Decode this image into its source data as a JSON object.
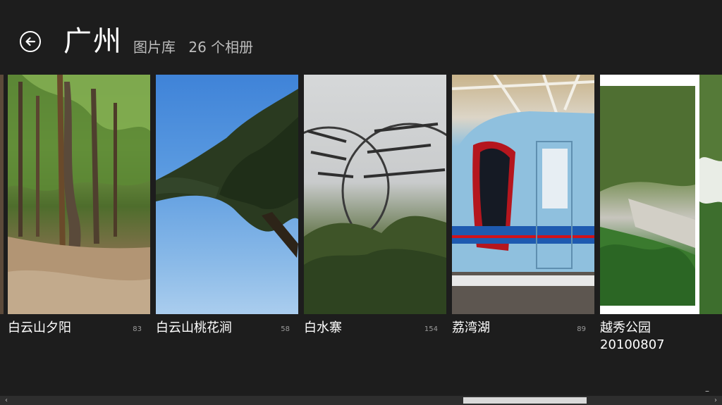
{
  "header": {
    "title": "广州",
    "library_label": "图片库",
    "album_count": "26 个相册"
  },
  "albums": [
    {
      "name": "白云山夕阳",
      "count": "83"
    },
    {
      "name": "白云山桃花涧",
      "count": "58"
    },
    {
      "name": "白水寨",
      "count": "154"
    },
    {
      "name": "荔湾湖",
      "count": "89"
    },
    {
      "name": "越秀公园\n20100807",
      "count": ""
    }
  ],
  "icons": {
    "back": "back-arrow-icon",
    "scroll_left": "chevron-left-icon",
    "scroll_right": "chevron-right-icon"
  },
  "scroll": {
    "left_glyph": "‹",
    "right_glyph": "›",
    "corner_glyph": "–"
  }
}
